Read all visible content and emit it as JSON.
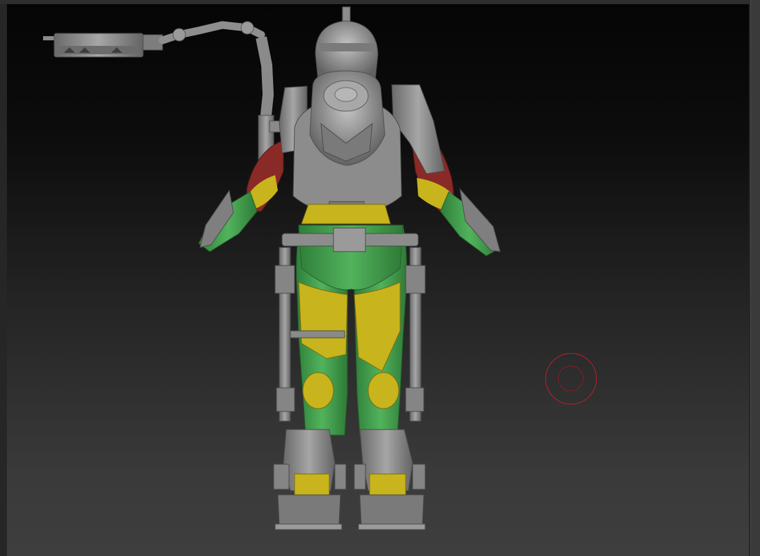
{
  "viewport": {
    "background_top": "#050505",
    "background_bottom": "#3e3e3e"
  },
  "model": {
    "subject": "exosuit-soldier-back-view",
    "colors": {
      "metal": "#8f8f8f",
      "metal_dark": "#5e5e5e",
      "suit_green": "#3f9e4a",
      "suit_yellow": "#c8b41c",
      "suit_red": "#8a2a26"
    }
  },
  "brush": {
    "icon": "brush-cursor-icon",
    "color": "#c0202a"
  }
}
